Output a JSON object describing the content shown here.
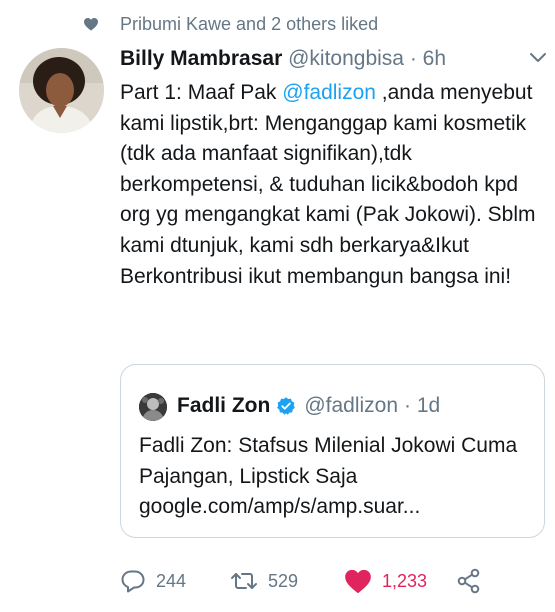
{
  "social_context": {
    "text": "Pribumi Kawe and 2 others liked",
    "icon": "heart-icon"
  },
  "tweet": {
    "display_name": "Billy Mambrasar",
    "handle": "@kitongbisa",
    "time": "· 6h",
    "text_parts": {
      "before_mention": "Part 1: Maaf Pak ",
      "mention": "@fadlizon",
      "after_mention": " ,anda menyebut kami lipstik,brt: Menganggap kami kosmetik (tdk ada manfaat signifikan),tdk berkompetensi, & tuduhan licik&bodoh kpd org yg mengangkat kami (Pak Jokowi). Sblm kami dtunjuk, kami sdh berkarya&Ikut Berkontribusi ikut membangun bangsa ini!"
    }
  },
  "quoted_tweet": {
    "display_name": "Fadli Zon",
    "handle": "@fadlizon",
    "time": "· 1d",
    "verified": true,
    "text": "Fadli Zon: Stafsus Milenial Jokowi Cuma Pajangan, Lipstick Saja google.com/amp/s/amp.suar..."
  },
  "actions": {
    "reply_count": "244",
    "retweet_count": "529",
    "like_count": "1,233"
  },
  "colors": {
    "link": "#1da1f2",
    "secondary_text": "#657786",
    "like_active": "#e0245e"
  }
}
